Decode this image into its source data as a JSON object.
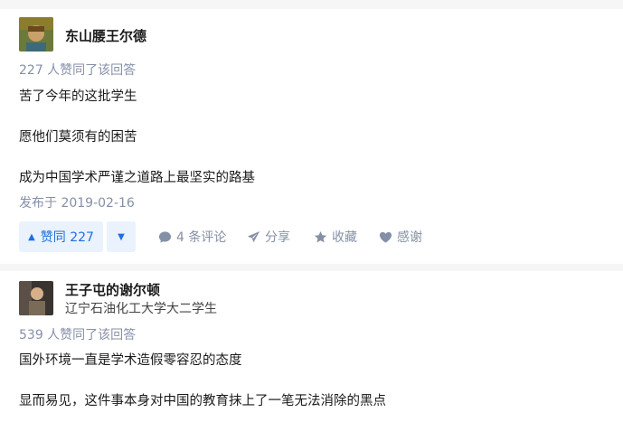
{
  "answer1": {
    "author": {
      "name": "东山腰王尔德"
    },
    "vote_summary": "227 人赞同了该回答",
    "paragraphs": [
      "苦了今年的这批学生",
      "愿他们莫须有的困苦",
      "成为中国学术严谨之道路上最坚实的路基"
    ],
    "date": "发布于 2019-02-16",
    "actions": {
      "upvote_label": "赞同 227",
      "comments": "4 条评论",
      "share": "分享",
      "favorite": "收藏",
      "thanks": "感谢"
    }
  },
  "answer2": {
    "author": {
      "name": "王子屯的谢尔顿",
      "bio": "辽宁石油化工大学大二学生"
    },
    "vote_summary": "539 人赞同了该回答",
    "paragraphs": [
      "国外环境一直是学术造假零容忍的态度",
      "显而易见，这件事本身对中国的教育抹上了一笔无法消除的黑点"
    ]
  },
  "colors": {
    "accent": "#1f6fe0",
    "accent_bg": "#eaf2fd",
    "meta": "#8590a6"
  }
}
